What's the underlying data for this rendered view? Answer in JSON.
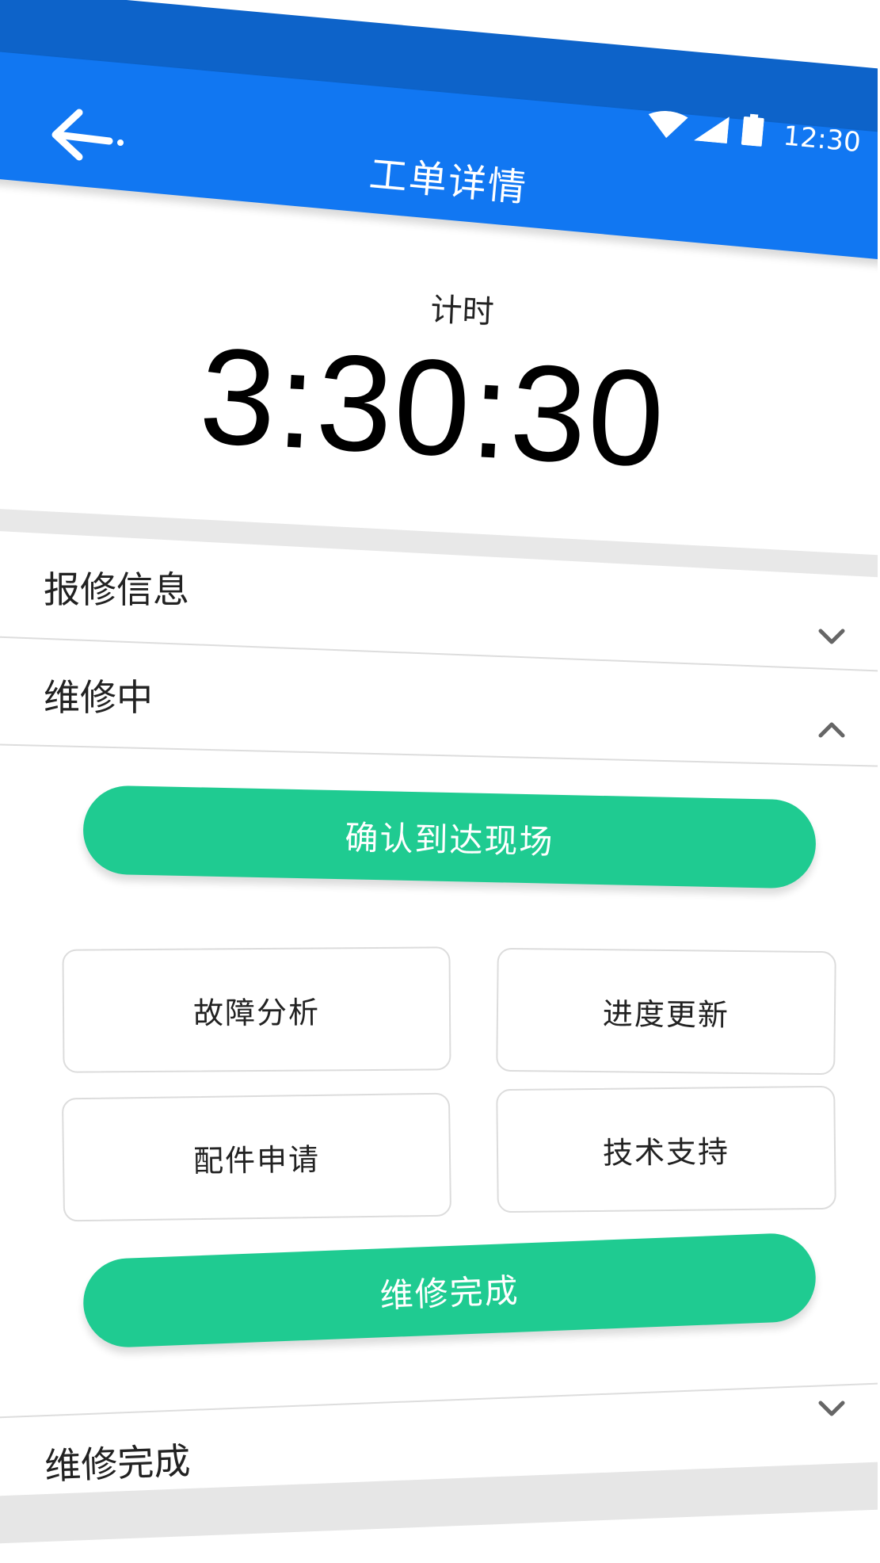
{
  "header": {
    "title": "工单详情",
    "back_icon": "arrow-left-icon",
    "bg_color": "#1177f2",
    "status_bar_color": "#0d63c9"
  },
  "status_bar": {
    "time": "12:30",
    "icons": [
      "wifi-icon",
      "signal-icon",
      "battery-icon"
    ]
  },
  "timer": {
    "label": "计时",
    "value": "3:30:30"
  },
  "sections": [
    {
      "label": "报修信息",
      "expanded": false,
      "chevron": "chevron-down-icon"
    },
    {
      "label": "维修中",
      "expanded": true,
      "chevron": "chevron-up-icon"
    },
    {
      "label": "维修完成",
      "expanded": false,
      "chevron": "chevron-down-icon"
    }
  ],
  "actions": {
    "confirm_arrival": "确认到达现场",
    "fault_analysis": "故障分析",
    "progress_update": "进度更新",
    "parts_request": "配件申请",
    "tech_support": "技术支持",
    "repair_complete": "维修完成"
  },
  "colors": {
    "accent_green": "#1fcb91",
    "text": "#222222"
  }
}
